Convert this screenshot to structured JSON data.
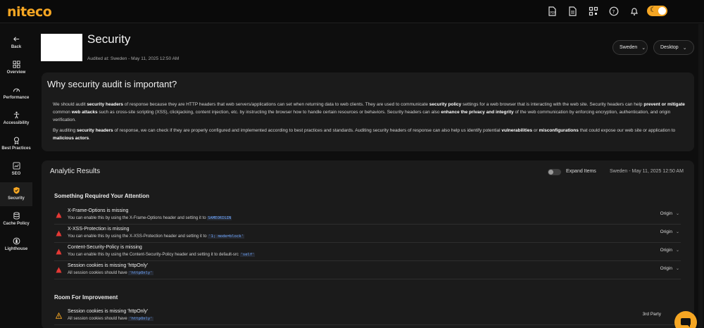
{
  "app": {
    "logo": "niteco",
    "accent": "#f5a623",
    "theme_icon": "moon-icon"
  },
  "topbar": {
    "icons": [
      "pdf-file-icon",
      "document-icon",
      "qr-grid-icon",
      "help-icon",
      "bell-icon"
    ]
  },
  "sidebar": {
    "items": [
      {
        "label": "Back",
        "icon": "arrow-left-icon"
      },
      {
        "label": "Overview",
        "icon": "grid-icon"
      },
      {
        "label": "Performance",
        "icon": "speedometer-icon"
      },
      {
        "label": "Accessibility",
        "icon": "person-icon"
      },
      {
        "label": "Best Practices",
        "icon": "award-icon"
      },
      {
        "label": "SEO",
        "icon": "seo-icon"
      },
      {
        "label": "Security",
        "icon": "shield-icon",
        "active": true
      },
      {
        "label": "Cache Policy",
        "icon": "database-icon"
      },
      {
        "label": "Lighthouse",
        "icon": "lighthouse-icon"
      }
    ]
  },
  "header": {
    "title": "Security",
    "audited": "Audited at: Sweden - May 11, 2025 12:50 AM",
    "country": "Sweden",
    "device": "Desktop"
  },
  "why": {
    "title": "Why security audit is important?",
    "p1_a": "We should audit ",
    "p1_b": "security headers",
    "p1_c": " of response because they are HTTP headers that web servers/applications can set when returning data to web clients. They are used to communicate ",
    "p1_d": "security policy",
    "p1_e": " settings for a web browser that is interacting with the web site. Security headers can help ",
    "p1_f": "prevent or mitigate",
    "p1_g": " common ",
    "p1_h": "web attacks",
    "p1_i": " such as cross-site scripting (XSS), clickjacking, content injection, etc. by instructing the browser how to handle certain resources or behaviors. Security headers can also ",
    "p1_j": "enhance the privacy and integrity",
    "p1_k": " of the web communication by enforcing encryption, authentication, and origin verification.",
    "p2_a": "By auditing ",
    "p2_b": "security headers",
    "p2_c": " of response, we can check if they are properly configured and implemented according to best practices and standards. Auditing security headers of response can also help us identify potential ",
    "p2_d": "vulnerabilities",
    "p2_e": " or ",
    "p2_f": "misconfigurations",
    "p2_g": " that could expose our web site or application to ",
    "p2_h": "malicious actors",
    "p2_i": "."
  },
  "results": {
    "title": "Analytic Results",
    "expand_label": "Expand Items",
    "expand_on": false,
    "date": "Sweden - May 11, 2025 12:50 AM",
    "section1_title": "Something Required Your Attention",
    "section2_title": "Room For Improvement",
    "attention": [
      {
        "title": "X-Frame-Options is missing",
        "desc": "You can enable this by using the X-Frame-Options header and setting it to ",
        "code": "SAMEORIGIN",
        "tag": "Origin"
      },
      {
        "title": "X-XSS-Protection is missing",
        "desc": "You can enable this by using the X-XSS-Protection header and setting it to ",
        "code": "'1; mode=block'",
        "tag": "Origin"
      },
      {
        "title": "Content-Security-Policy is missing",
        "desc": "You can enable this by using the Content-Security-Policy header and setting it to default-src ",
        "code": "'self'",
        "tag": "Origin"
      },
      {
        "title": "Session cookies is missing 'httpOnly'",
        "desc": "All session cookies should have ",
        "code": "'httpOnly'",
        "tag": "Origin"
      }
    ],
    "improvement": [
      {
        "title": "Session cookies is missing 'httpOnly'",
        "desc": "All session cookies should have ",
        "code": "'httpOnly'",
        "tag": "3rd Party"
      }
    ],
    "colors": {
      "error": "#e53935",
      "warning": "#f5a623",
      "code": "#6fa8ff"
    }
  },
  "chat": {
    "icon": "chat-bubble-icon"
  }
}
